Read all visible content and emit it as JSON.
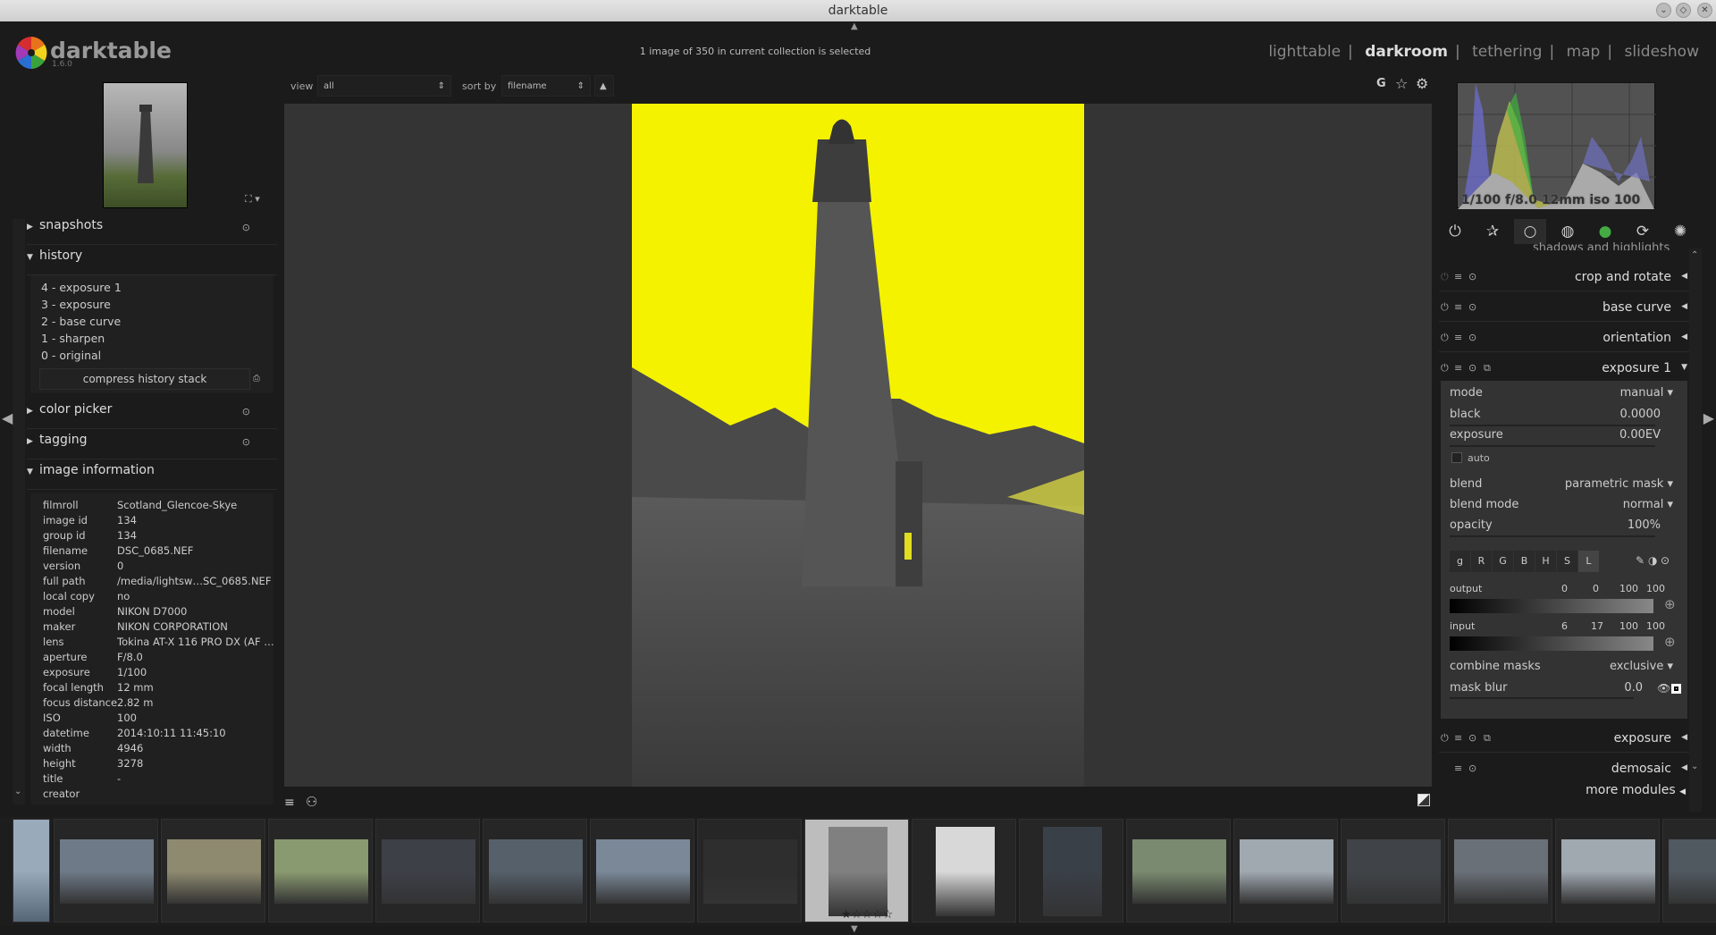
{
  "window": {
    "title": "darktable"
  },
  "app": {
    "name": "darktable",
    "version": "1.6.0"
  },
  "status": "1 image of 350 in current collection is selected",
  "views": [
    {
      "label": "lighttable",
      "active": false
    },
    {
      "label": "darkroom",
      "active": true
    },
    {
      "label": "tethering",
      "active": false
    },
    {
      "label": "map",
      "active": false
    },
    {
      "label": "slideshow",
      "active": false
    }
  ],
  "view_separator": "|",
  "top_toolbar": {
    "view_label": "view",
    "view_value": "all",
    "sort_label": "sort by",
    "sort_value": "filename",
    "sort_dir": "▲",
    "g_label": "G"
  },
  "left": {
    "snapshots": "snapshots",
    "history": {
      "title": "history",
      "items": [
        "4 - exposure 1",
        "3 - exposure",
        "2 - base curve",
        "1 - sharpen",
        "0 - original"
      ],
      "compress": "compress history stack"
    },
    "color_picker": "color picker",
    "tagging": "tagging",
    "image_information": {
      "title": "image information",
      "rows": [
        [
          "filmroll",
          "Scotland_Glencoe-Skye"
        ],
        [
          "image id",
          "134"
        ],
        [
          "group id",
          "134"
        ],
        [
          "filename",
          "DSC_0685.NEF"
        ],
        [
          "version",
          "0"
        ],
        [
          "full path",
          "/media/lightsw…SC_0685.NEF"
        ],
        [
          "local copy",
          "no"
        ],
        [
          "model",
          "NIKON D7000"
        ],
        [
          "maker",
          "NIKON CORPORATION"
        ],
        [
          "lens",
          "Tokina AT-X 116 PRO DX (AF …"
        ],
        [
          "aperture",
          "F/8.0"
        ],
        [
          "exposure",
          "1/100"
        ],
        [
          "focal length",
          "12 mm"
        ],
        [
          "focus distance",
          "2.82 m"
        ],
        [
          "ISO",
          "100"
        ],
        [
          "datetime",
          "2014:10:11 11:45:10"
        ],
        [
          "width",
          "4946"
        ],
        [
          "height",
          "3278"
        ],
        [
          "title",
          "-"
        ],
        [
          "creator",
          ""
        ]
      ]
    }
  },
  "right": {
    "histogram_info": "1/100 f/8.0 12mm iso 100",
    "partial_module": "shadows and highlights",
    "modules": [
      {
        "name": "crop and rotate"
      },
      {
        "name": "base curve"
      },
      {
        "name": "orientation"
      },
      {
        "name": "exposure 1",
        "expanded": true
      },
      {
        "name": "exposure"
      },
      {
        "name": "demosaic"
      }
    ],
    "more_modules": "more modules",
    "exposure_params": {
      "mode_label": "mode",
      "mode_value": "manual",
      "black_label": "black",
      "black_value": "0.0000",
      "exposure_label": "exposure",
      "exposure_value": "0.00EV",
      "auto_label": "auto",
      "blend_label": "blend",
      "blend_value": "parametric mask",
      "blend_mode_label": "blend mode",
      "blend_mode_value": "normal",
      "opacity_label": "opacity",
      "opacity_value": "100%",
      "channel_tabs": [
        "g",
        "R",
        "G",
        "B",
        "H",
        "S",
        "L"
      ],
      "active_channel": "L",
      "output_label": "output",
      "output_values": [
        "0",
        "0",
        "100",
        "100"
      ],
      "input_label": "input",
      "input_values": [
        "6",
        "17",
        "100",
        "100"
      ],
      "combine_label": "combine masks",
      "combine_value": "exclusive",
      "mask_blur_label": "mask blur",
      "mask_blur_value": "0.0"
    }
  },
  "filmstrip": {
    "count": 16,
    "selected_index": 7,
    "rating_stars": "★☆☆☆☆"
  },
  "colors": {
    "mask_highlight": "#f5f200",
    "background": "#1b1b1b",
    "panel": "#333333"
  }
}
